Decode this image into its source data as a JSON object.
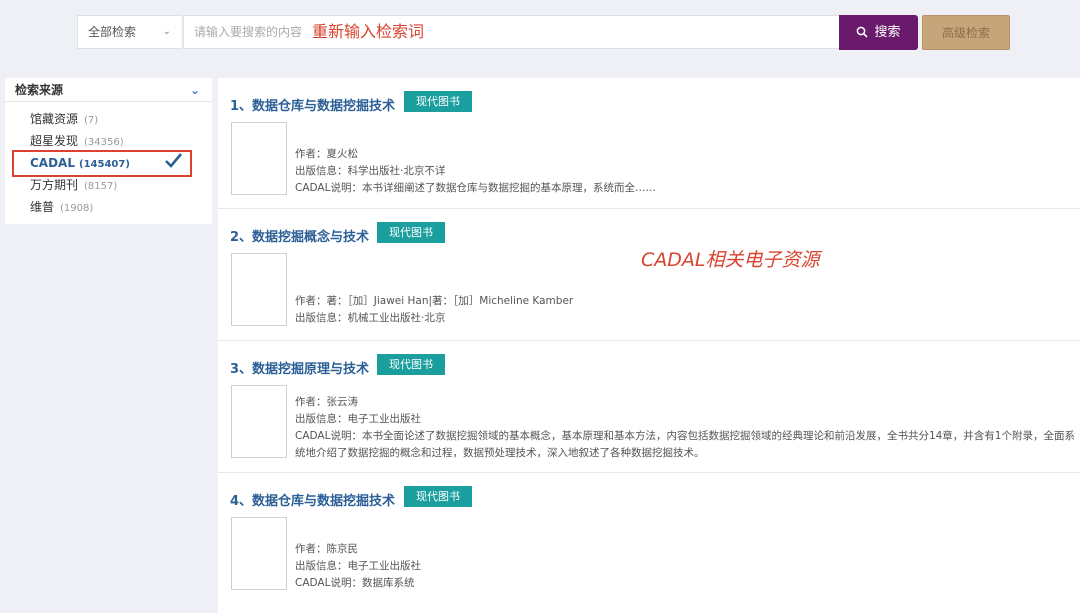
{
  "search": {
    "scope_label": "全部检索",
    "placeholder": "请输入要搜索的内容",
    "annotation": "重新输入检索词",
    "search_label": "搜索",
    "advanced_label": "高级检索"
  },
  "sidebar": {
    "title": "检索来源",
    "items": [
      {
        "label": "馆藏资源",
        "count": "(7)"
      },
      {
        "label": "超星发现",
        "count": "(34356)"
      },
      {
        "label": "CADAL",
        "count": "(145407)"
      },
      {
        "label": "万方期刊",
        "count": "(8157)"
      },
      {
        "label": "维普",
        "count": "(1908)"
      }
    ]
  },
  "annotation_main": "CADAL相关电子资源",
  "results": [
    {
      "title": "1、数据仓库与数据挖掘技术",
      "tag": "现代图书",
      "author": "作者：夏火松",
      "pub": "出版信息：科学出版社·北京不详",
      "desc": "CADAL说明：本书详细阐述了数据仓库与数据挖掘的基本原理，系统而全……"
    },
    {
      "title": "2、数据挖掘概念与技术",
      "tag": "现代图书",
      "author": "作者：著：［加］Jiawei Han|著：［加］Micheline Kamber",
      "pub": "出版信息：机械工业出版社·北京"
    },
    {
      "title": "3、数据挖掘原理与技术",
      "tag": "现代图书",
      "author": "作者：张云涛",
      "pub": "出版信息：电子工业出版社",
      "desc": "CADAL说明：本书全面论述了数据挖掘领域的基本概念，基本原理和基本方法，内容包括数据挖掘领域的经典理论和前沿发展，全书共分14章，并含有1个附录，全面系统地介绍了数据挖掘的概念和过程，数据预处理技术，深入地叙述了各种数据挖掘技术。"
    },
    {
      "title": "4、数据仓库与数据挖掘技术",
      "tag": "现代图书",
      "author": "作者：陈京民",
      "pub": "出版信息：电子工业出版社",
      "desc": "CADAL说明：数据库系统"
    }
  ]
}
